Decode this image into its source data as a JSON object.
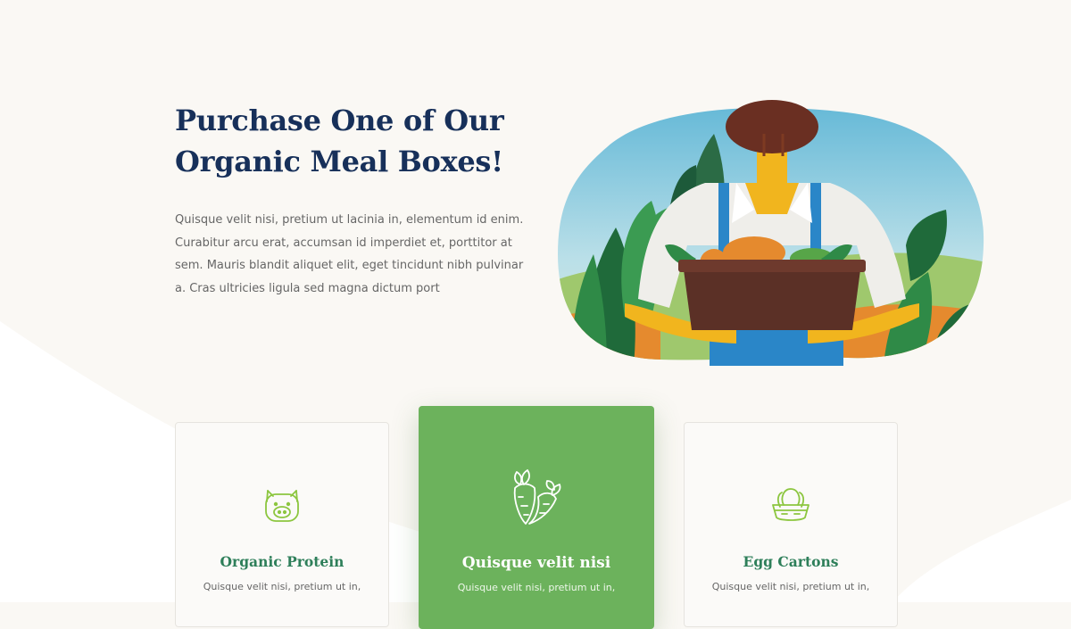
{
  "hero": {
    "title_lines": [
      "Purchase One of Our",
      "Organic Meal Boxes!"
    ],
    "description_lines": [
      "Quisque velit nisi, pretium ut lacinia in, elementum id enim.",
      "Curabitur arcu erat, accumsan id imperdiet et, porttitor at",
      "sem. Mauris blandit aliquet elit, eget tincidunt nibh pulvinar",
      "a. Cras ultricies ligula sed magna dictum port"
    ],
    "illustration": "farmer-holding-vegetable-basket"
  },
  "cards": [
    {
      "icon": "pig-icon",
      "title": "Organic Protein",
      "text": "Quisque velit nisi, pretium ut in,"
    },
    {
      "icon": "carrots-icon",
      "title": "Quisque velit nisi",
      "text": "Quisque velit nisi, pretium ut in,"
    },
    {
      "icon": "egg-carton-icon",
      "title": "Egg Cartons",
      "text": "Quisque velit nisi, pretium ut in,"
    }
  ],
  "colors": {
    "background": "#faf8f4",
    "title": "#17305a",
    "accent_green": "#6cb25c",
    "icon_green": "#8cc63f",
    "card_title_green": "#2e7f5a"
  }
}
